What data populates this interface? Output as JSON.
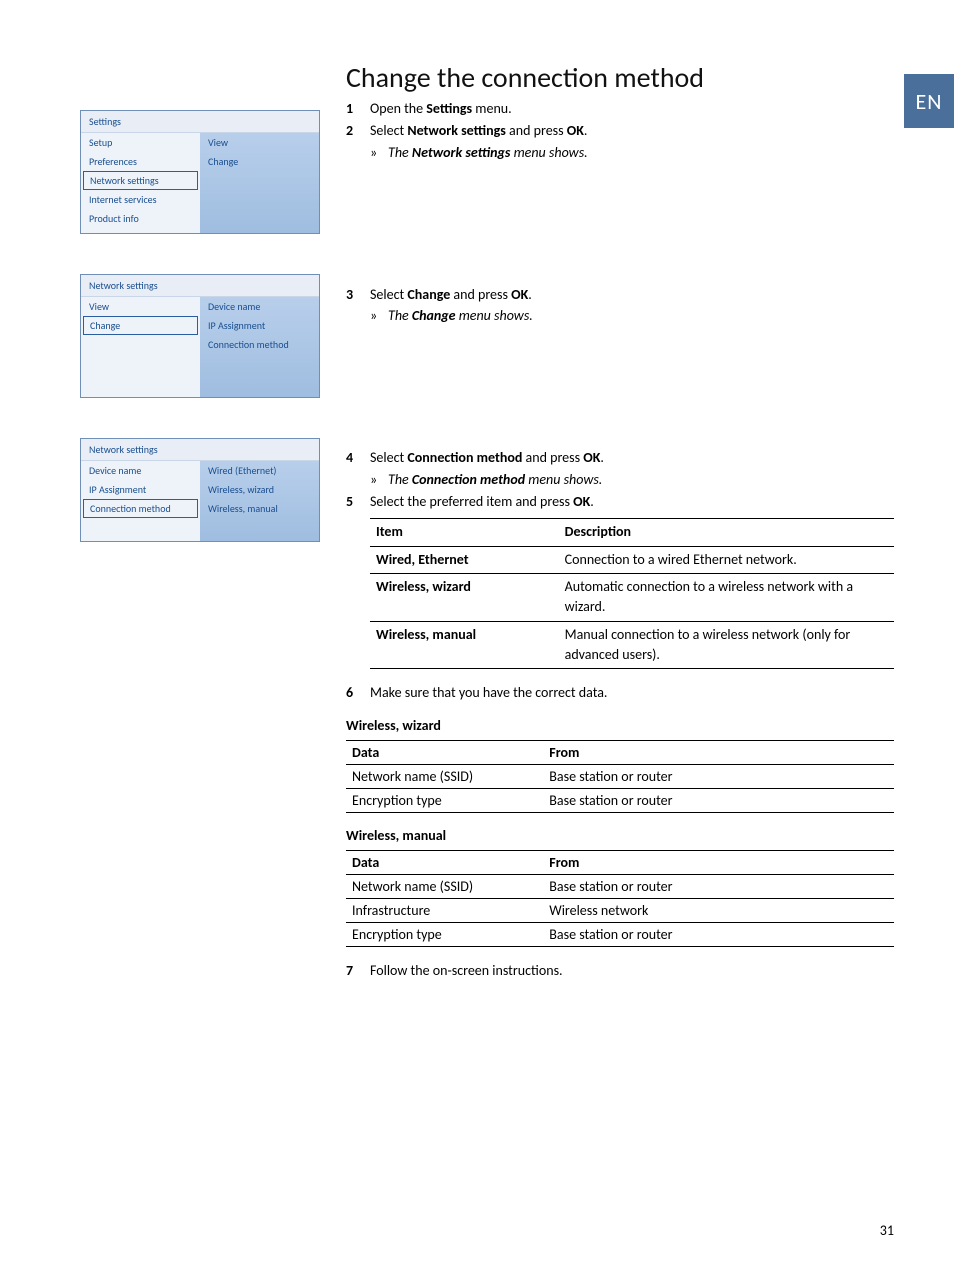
{
  "language_tab": "EN",
  "page_number": "31",
  "title": "Change the connection method",
  "steps": {
    "s1": {
      "text_a": "Open the ",
      "bold": "Settings",
      "text_b": " menu."
    },
    "s2": {
      "text_a": "Select ",
      "bold1": "Network settings",
      "text_b": " and press ",
      "bold2": "OK",
      "text_c": "."
    },
    "s2_result": {
      "prefix": "The ",
      "bold": "Network settings",
      "suffix": " menu shows."
    },
    "s3": {
      "text_a": "Select ",
      "bold1": "Change",
      "text_b": " and press ",
      "bold2": "OK",
      "text_c": "."
    },
    "s3_result": {
      "prefix": "The ",
      "bold": "Change",
      "suffix": " menu shows."
    },
    "s4": {
      "text_a": "Select ",
      "bold1": "Connection method",
      "text_b": " and press ",
      "bold2": "OK",
      "text_c": "."
    },
    "s4_result": {
      "prefix": "The ",
      "bold": "Connection method",
      "suffix": " menu shows."
    },
    "s5": {
      "text_a": "Select the preferred item and press ",
      "bold": "OK",
      "text_b": "."
    },
    "s6": {
      "text": "Make sure that you have the correct data."
    },
    "s7": {
      "text": "Follow the on-screen instructions."
    }
  },
  "table_items": {
    "head_item": "Item",
    "head_desc": "Description",
    "rows": [
      {
        "item": "Wired, Ethernet",
        "desc": "Connection to a wired Ethernet network."
      },
      {
        "item": "Wireless, wizard",
        "desc": "Automatic connection to a wireless network with a wizard."
      },
      {
        "item": "Wireless, manual",
        "desc": "Manual connection to a wireless network (only for advanced users)."
      }
    ]
  },
  "sub_wizard": {
    "heading": "Wireless, wizard",
    "head_data": "Data",
    "head_from": "From",
    "rows": [
      {
        "data": "Network name (SSID)",
        "from": "Base station or router"
      },
      {
        "data": "Encryption type",
        "from": "Base station or router"
      }
    ]
  },
  "sub_manual": {
    "heading": "Wireless, manual",
    "head_data": "Data",
    "head_from": "From",
    "rows": [
      {
        "data": "Network name (SSID)",
        "from": "Base station or router"
      },
      {
        "data": "Infrastructure",
        "from": "Wireless network"
      },
      {
        "data": "Encryption type",
        "from": "Base station or router"
      }
    ]
  },
  "panel1": {
    "header": "Settings",
    "left": [
      "Setup",
      "Preferences",
      "Network settings",
      "Internet services",
      "Product info"
    ],
    "selected_left_index": 2,
    "right": [
      "View",
      "Change"
    ]
  },
  "panel2": {
    "header": "Network settings",
    "left": [
      "View",
      "Change"
    ],
    "selected_left_index": 1,
    "right": [
      "Device name",
      "IP Assignment",
      "Connection method"
    ]
  },
  "panel3": {
    "header": "Network settings",
    "left": [
      "Device name",
      "IP Assignment",
      "Connection method"
    ],
    "selected_left_index": 2,
    "right": [
      "Wired (Ethernet)",
      "Wireless, wizard",
      "Wireless, manual"
    ]
  }
}
